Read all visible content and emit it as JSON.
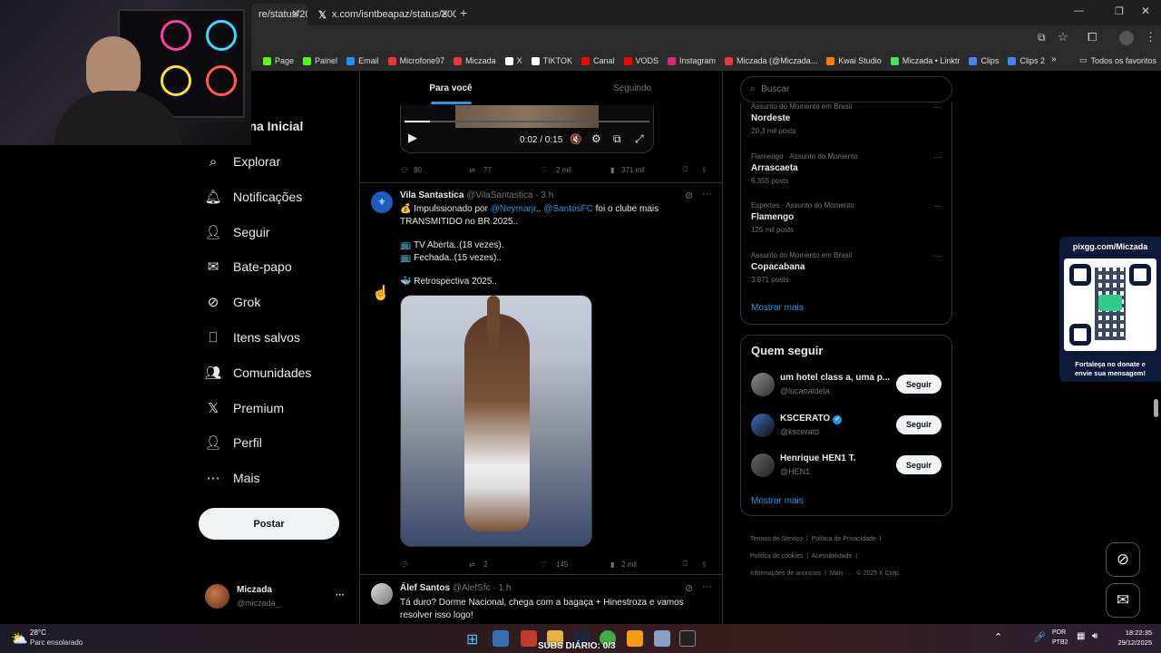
{
  "browser": {
    "tabs": [
      {
        "title": "re/status/20"
      },
      {
        "title": "x.com/isntbeapaz/status/20056"
      }
    ],
    "new_tab": "+",
    "bookmarks": [
      {
        "label": "Page",
        "color": "#53fc18"
      },
      {
        "label": "Painel",
        "color": "#53fc18"
      },
      {
        "label": "Email",
        "color": "#1e90ff"
      },
      {
        "label": "Microfone97",
        "color": "#e53935"
      },
      {
        "label": "Miczada",
        "color": "#e53935"
      },
      {
        "label": "X",
        "color": "#ffffff"
      },
      {
        "label": "TIKTOK",
        "color": "#ffffff"
      },
      {
        "label": "Canal",
        "color": "#ff0000"
      },
      {
        "label": "VODS",
        "color": "#ff0000"
      },
      {
        "label": "Instagram",
        "color": "#d62976"
      },
      {
        "label": "Miczada (@Miczada...",
        "color": "#e53935"
      },
      {
        "label": "Kwai Studio",
        "color": "#ff7a00"
      },
      {
        "label": "Miczada • Linktr",
        "color": "#43e660"
      },
      {
        "label": "Clips",
        "color": "#4285f4"
      },
      {
        "label": "Clips 2",
        "color": "#4285f4"
      }
    ],
    "all_bookmarks": "Todos os favoritos"
  },
  "sidebar": {
    "title": "gina Inicial",
    "items": [
      {
        "label": "Explorar",
        "icon": "search-icon"
      },
      {
        "label": "Notificações",
        "icon": "bell-icon"
      },
      {
        "label": "Seguir",
        "icon": "person-add-icon"
      },
      {
        "label": "Bate-papo",
        "icon": "mail-icon"
      },
      {
        "label": "Grok",
        "icon": "grok-icon"
      },
      {
        "label": "Itens salvos",
        "icon": "bookmark-icon"
      },
      {
        "label": "Comunidades",
        "icon": "communities-icon"
      },
      {
        "label": "Premium",
        "icon": "x-logo-icon"
      },
      {
        "label": "Perfil",
        "icon": "person-icon"
      },
      {
        "label": "Mais",
        "icon": "more-circle-icon"
      }
    ],
    "post_button": "Postar",
    "account": {
      "name": "Miczada",
      "handle": "@miczada_",
      "more": "···"
    }
  },
  "feed": {
    "tabs": [
      {
        "label": "Para você",
        "active": true
      },
      {
        "label": "Seguindo",
        "active": false
      }
    ],
    "video_post": {
      "time": "0:02 / 0:15",
      "actions": {
        "replies": "80",
        "reposts": "77",
        "likes": "2 mil",
        "views": "371 mil"
      }
    },
    "post1": {
      "name": "Vila Santastica",
      "handle": "@VilaSantastica",
      "time": "· 3 h",
      "line1_pre": "💰 Impulssionado por ",
      "mention1": "@Neymarjr",
      "line1_mid": ".. ",
      "mention2": "@SantosFC",
      "line1_post": " foi o clube mais",
      "line2": "TRANSMITIDO no BR 2025..",
      "line3": "📺 TV Aberta..(18 vezes).",
      "line4": "📺  Fechada..(15 vezes)..",
      "line5": "🐳 Retrospectiva 2025..",
      "actions": {
        "replies": "",
        "reposts": "2",
        "likes": "145",
        "views": "2 mil"
      }
    },
    "post2": {
      "name": "Álef Santos",
      "handle": "@AlefSfc",
      "time": "· 1 h",
      "line1": "Tá duro? Dorme Nacional,  chega com a bagaça + Hinestroza e vamos",
      "line2": "resolver isso logo!"
    }
  },
  "right": {
    "search_placeholder": "Buscar",
    "trends": [
      {
        "meta": "Assunto do Momento em Brasil",
        "name": "Nordeste",
        "count": "20,3 mil posts"
      },
      {
        "meta": "Flamengo · Assunto do Momento",
        "name": "Arrascaeta",
        "count": "6.355 posts"
      },
      {
        "meta": "Esportes · Assunto do Momento",
        "name": "Flamengo",
        "count": "125 mil posts"
      },
      {
        "meta": "Assunto do Momento em Brasil",
        "name": "Copacabana",
        "count": "3.971 posts"
      }
    ],
    "show_more": "Mostrar mais",
    "who_to_follow_title": "Quem seguir",
    "follow": [
      {
        "name": "um hotel class a, uma p...",
        "handle": "@lucaoaldeia",
        "button": "Seguir"
      },
      {
        "name": "KSCERATO",
        "handle": "@kscerato",
        "button": "Seguir"
      },
      {
        "name": "Henrique HEN1 T.",
        "handle": "@HEN1",
        "button": "Seguir"
      }
    ],
    "show_more2": "Mostrar mais",
    "footer": {
      "l1": "Termos de Serviço",
      "l2": "Política de Privacidade",
      "l3": "Política de cookies",
      "l4": "Acessibilidade",
      "l5": "Informações de anúncios",
      "l6": "Mais ···",
      "l7": "© 2025 X Corp."
    }
  },
  "overlay": {
    "pix_url": "pixgg.com/Miczada",
    "pix_text1": "Fortaleça no donate e",
    "pix_text2": "envie sua mensagem!"
  },
  "taskbar": {
    "temp": "28°C",
    "weather": "Parc ensolarado",
    "subs": "SUBS DIÁRIO: 0/3",
    "lang1": "POR",
    "lang2": "PTB2",
    "time": "18:22:35",
    "date": "29/12/2025"
  }
}
